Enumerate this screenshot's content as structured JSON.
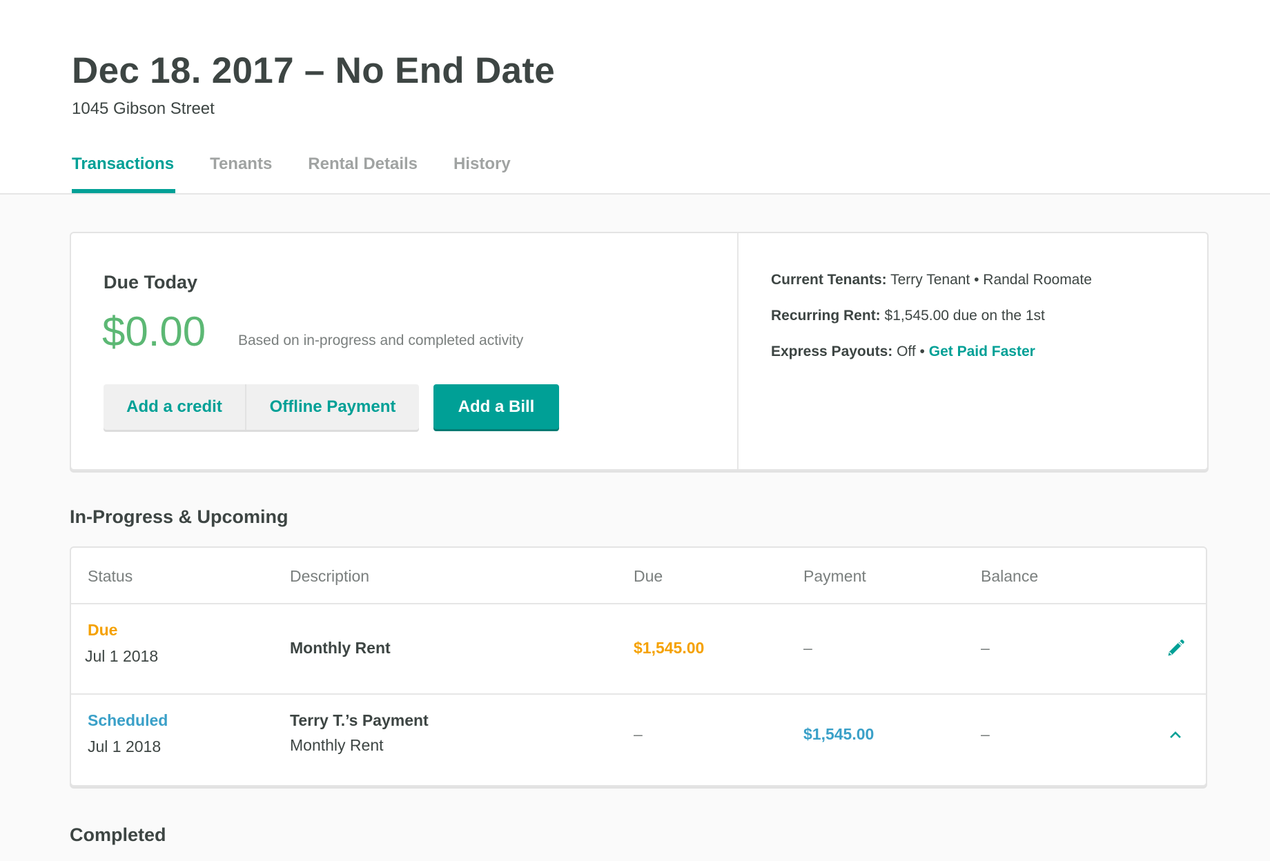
{
  "header": {
    "title": "Dec 18. 2017 – No End Date",
    "address": "1045 Gibson Street",
    "tabs": [
      {
        "label": "Transactions",
        "active": true
      },
      {
        "label": "Tenants",
        "active": false
      },
      {
        "label": "Rental Details",
        "active": false
      },
      {
        "label": "History",
        "active": false
      }
    ]
  },
  "summary": {
    "due_label": "Due Today",
    "due_amount": "$0.00",
    "due_note": "Based on in-progress and completed activity",
    "buttons": {
      "add_credit": "Add a credit",
      "offline_payment": "Offline Payment",
      "add_bill": "Add a Bill"
    },
    "info": {
      "tenants_label": "Current Tenants:",
      "tenants_value": "Terry Tenant • Randal Roomate",
      "rent_label": "Recurring Rent:",
      "rent_value": "$1,545.00 due on the 1st",
      "payouts_label": "Express Payouts:",
      "payouts_value": "Off •",
      "payouts_link": "Get Paid Faster"
    }
  },
  "upcoming": {
    "title": "In-Progress & Upcoming",
    "columns": [
      "Status",
      "Description",
      "Due",
      "Payment",
      "Balance"
    ],
    "rows": [
      {
        "status": "Due",
        "date": "Jul 1 2018",
        "description": "Monthly Rent",
        "sub_description": "",
        "due": "$1,545.00",
        "payment": "–",
        "balance": "–",
        "action_icon": "pencil-icon"
      },
      {
        "status": "Scheduled",
        "date": "Jul 1 2018",
        "description": "Terry T.’s Payment",
        "sub_description": "Monthly Rent",
        "due": "–",
        "payment": "$1,545.00",
        "balance": "–",
        "action_icon": "chevron-up-icon"
      }
    ]
  },
  "completed": {
    "title": "Completed"
  },
  "colors": {
    "accent": "#00a096",
    "due_today_green": "#5cb874",
    "status_due": "#f5a100",
    "status_scheduled": "#3aa0c8"
  }
}
